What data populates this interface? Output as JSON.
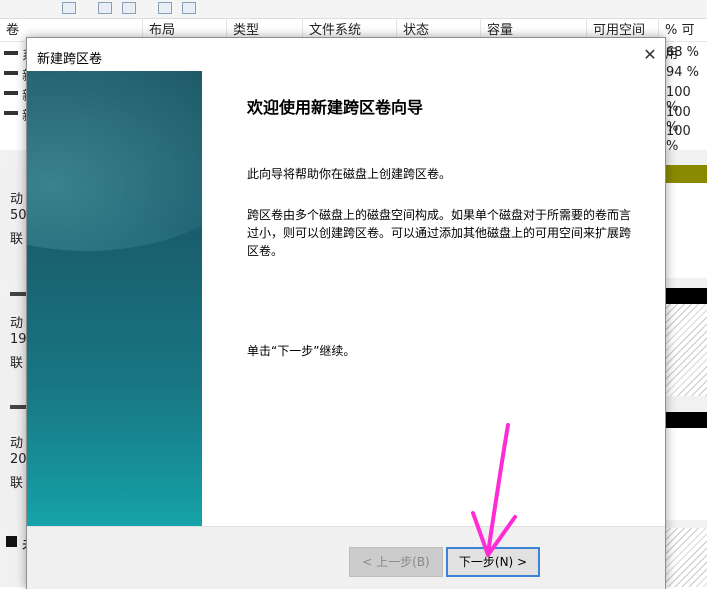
{
  "background_window": {
    "columns": [
      "卷",
      "布局",
      "类型",
      "文件系统",
      "状态",
      "容量",
      "可用空间",
      "% 可用"
    ],
    "volume_fragments": [
      "系",
      "新",
      "新",
      "新"
    ],
    "percent_free": [
      "68 %",
      "94 %",
      "100 %",
      "100 %",
      "100 %"
    ],
    "disk_label_fragments": [
      [
        "动",
        "50",
        "联"
      ],
      [
        "动",
        "19",
        "联"
      ],
      [
        "动",
        "20",
        "联"
      ]
    ],
    "legend_fragment": "未"
  },
  "dialog": {
    "title": "新建跨区卷",
    "close_glyph": "✕",
    "heading": "欢迎使用新建跨区卷向导",
    "intro": "此向导将帮助你在磁盘上创建跨区卷。",
    "description": "跨区卷由多个磁盘上的磁盘空间构成。如果单个磁盘对于所需要的卷而言过小，则可以创建跨区卷。可以通过添加其他磁盘上的可用空间来扩展跨区卷。",
    "continue_hint": "单击“下一步”继续。",
    "back_button": "< 上一步(B)",
    "next_button": "下一步(N) >"
  },
  "colors": {
    "annotation_arrow": "#ff2bd6",
    "next_button_border": "#3a83d6",
    "side_panel_top": "#1e5b6a",
    "side_panel_bottom": "#16a3a9",
    "olive_bar": "#8a8a00"
  },
  "icons": {
    "close": "close-icon",
    "arrow": "annotation-arrow"
  }
}
